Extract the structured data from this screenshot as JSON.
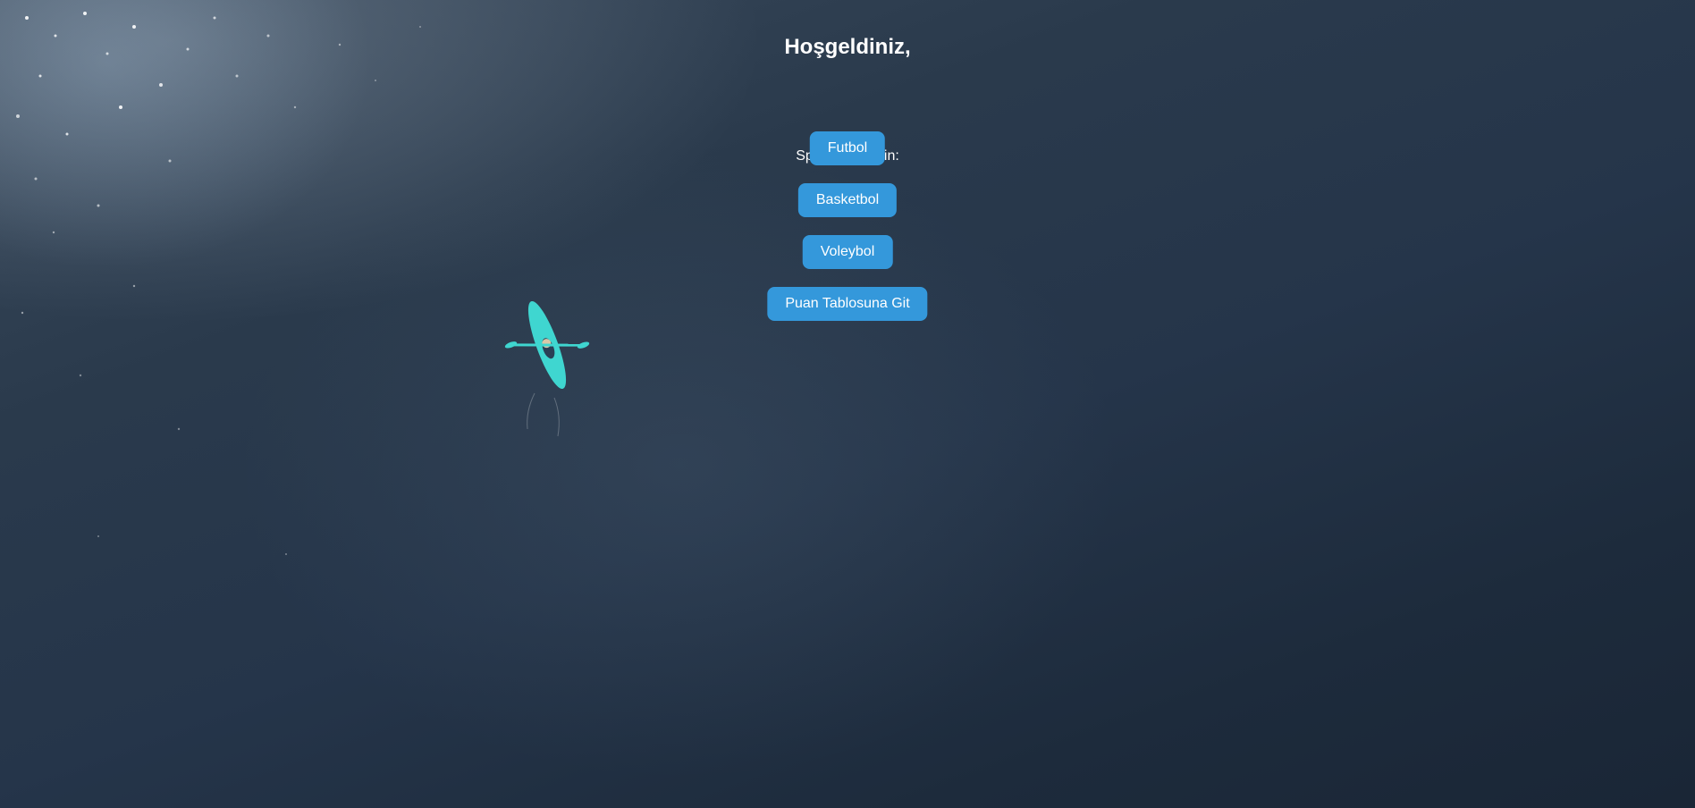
{
  "page": {
    "title": "Hoşgeldiniz,",
    "subtitle": "Spor Dalı Seçin:"
  },
  "buttons": {
    "futbol": "Futbol",
    "basketbol": "Basketbol",
    "voleybol": "Voleybol",
    "standings": "Puan Tablosuna Git"
  },
  "background": {
    "scene": "aerial view of dark ocean water with a turquoise kayak",
    "water_color": "#25354a",
    "kayak_color": "#3fd6d0",
    "button_color": "#3498db"
  }
}
